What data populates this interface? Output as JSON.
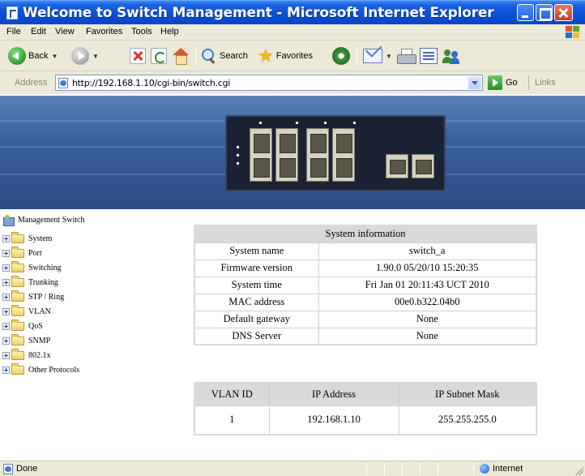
{
  "window": {
    "title": "Welcome to Switch Management - Microsoft Internet Explorer"
  },
  "menu": [
    "File",
    "Edit",
    "View",
    "Favorites",
    "Tools",
    "Help"
  ],
  "toolbar": {
    "back_label": "Back",
    "search_label": "Search",
    "favorites_label": "Favorites"
  },
  "address": {
    "label": "Address",
    "url": "http://192.168.1.10/cgi-bin/switch.cgi",
    "go_label": "Go",
    "links_label": "Links"
  },
  "tree": {
    "root": "Management Switch",
    "items": [
      "System",
      "Port",
      "Switching",
      "Trunking",
      "STP / Ring",
      "VLAN",
      "QoS",
      "SNMP",
      "802.1x",
      "Other Protocols"
    ]
  },
  "system_info": {
    "header": "System information",
    "rows": [
      {
        "label": "System name",
        "value": "switch_a"
      },
      {
        "label": "Firmware version",
        "value": "1.90.0 05/20/10 15:20:35"
      },
      {
        "label": "System time",
        "value": "Fri Jan 01 20:11:43 UCT 2010"
      },
      {
        "label": "MAC address",
        "value": "00e0.b322.04b0"
      },
      {
        "label": "Default gateway",
        "value": "None"
      },
      {
        "label": "DNS Server",
        "value": "None"
      }
    ]
  },
  "vlan_table": {
    "headers": [
      "VLAN ID",
      "IP Address",
      "IP Subnet Mask"
    ],
    "rows": [
      {
        "vlan_id": "1",
        "ip": "192.168.1.10",
        "mask": "255.255.255.0"
      }
    ]
  },
  "status": {
    "text": "Done",
    "zone": "Internet"
  }
}
